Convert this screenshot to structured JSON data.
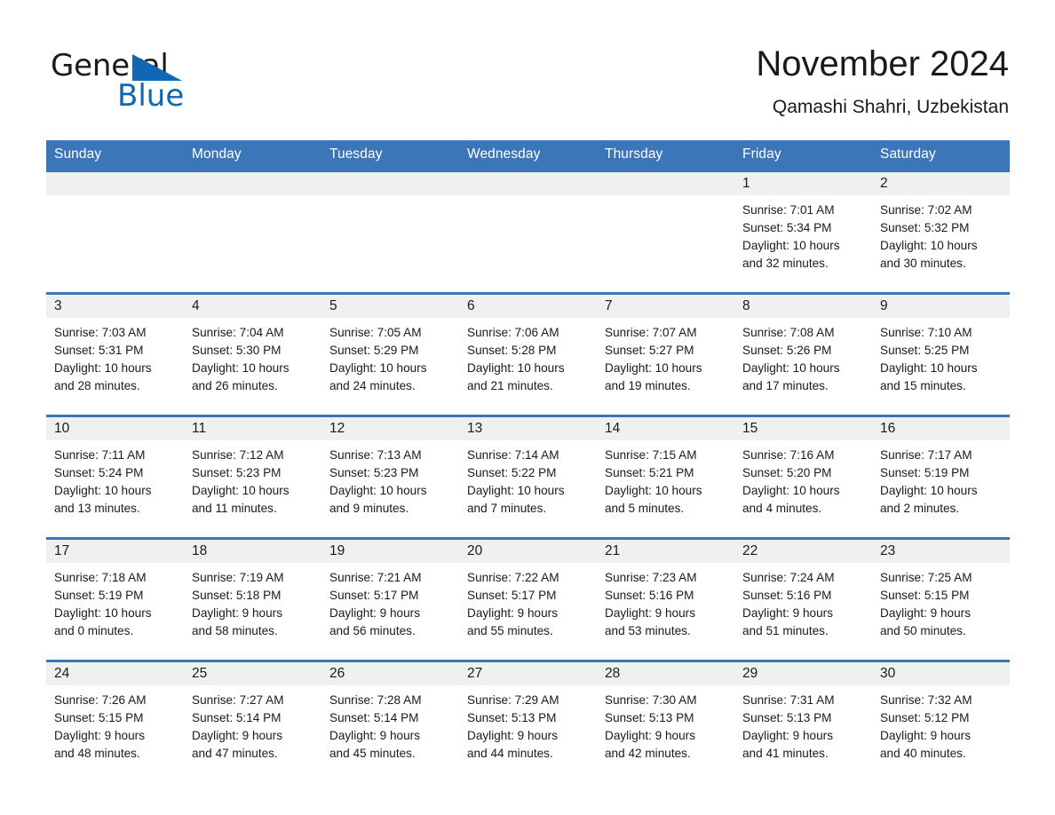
{
  "brand": {
    "word1": "General",
    "word2": "Blue",
    "triangle_color": "#1068b4",
    "text_color": "#1a1a1a"
  },
  "header": {
    "month_title": "November 2024",
    "location": "Qamashi Shahri, Uzbekistan"
  },
  "theme": {
    "header_blue": "#3a76b8",
    "daynum_band": "#f0f0f0",
    "cell_background": "#ffffff",
    "text": "#1a1a1a"
  },
  "weekday_headers": [
    "Sunday",
    "Monday",
    "Tuesday",
    "Wednesday",
    "Thursday",
    "Friday",
    "Saturday"
  ],
  "labels": {
    "sunrise_prefix": "Sunrise:",
    "sunset_prefix": "Sunset:",
    "daylight_prefix": "Daylight:"
  },
  "weeks": [
    [
      {
        "day": "",
        "lines": []
      },
      {
        "day": "",
        "lines": []
      },
      {
        "day": "",
        "lines": []
      },
      {
        "day": "",
        "lines": []
      },
      {
        "day": "",
        "lines": []
      },
      {
        "day": "1",
        "lines": [
          "Sunrise: 7:01 AM",
          "Sunset: 5:34 PM",
          "Daylight: 10 hours",
          "and 32 minutes."
        ]
      },
      {
        "day": "2",
        "lines": [
          "Sunrise: 7:02 AM",
          "Sunset: 5:32 PM",
          "Daylight: 10 hours",
          "and 30 minutes."
        ]
      }
    ],
    [
      {
        "day": "3",
        "lines": [
          "Sunrise: 7:03 AM",
          "Sunset: 5:31 PM",
          "Daylight: 10 hours",
          "and 28 minutes."
        ]
      },
      {
        "day": "4",
        "lines": [
          "Sunrise: 7:04 AM",
          "Sunset: 5:30 PM",
          "Daylight: 10 hours",
          "and 26 minutes."
        ]
      },
      {
        "day": "5",
        "lines": [
          "Sunrise: 7:05 AM",
          "Sunset: 5:29 PM",
          "Daylight: 10 hours",
          "and 24 minutes."
        ]
      },
      {
        "day": "6",
        "lines": [
          "Sunrise: 7:06 AM",
          "Sunset: 5:28 PM",
          "Daylight: 10 hours",
          "and 21 minutes."
        ]
      },
      {
        "day": "7",
        "lines": [
          "Sunrise: 7:07 AM",
          "Sunset: 5:27 PM",
          "Daylight: 10 hours",
          "and 19 minutes."
        ]
      },
      {
        "day": "8",
        "lines": [
          "Sunrise: 7:08 AM",
          "Sunset: 5:26 PM",
          "Daylight: 10 hours",
          "and 17 minutes."
        ]
      },
      {
        "day": "9",
        "lines": [
          "Sunrise: 7:10 AM",
          "Sunset: 5:25 PM",
          "Daylight: 10 hours",
          "and 15 minutes."
        ]
      }
    ],
    [
      {
        "day": "10",
        "lines": [
          "Sunrise: 7:11 AM",
          "Sunset: 5:24 PM",
          "Daylight: 10 hours",
          "and 13 minutes."
        ]
      },
      {
        "day": "11",
        "lines": [
          "Sunrise: 7:12 AM",
          "Sunset: 5:23 PM",
          "Daylight: 10 hours",
          "and 11 minutes."
        ]
      },
      {
        "day": "12",
        "lines": [
          "Sunrise: 7:13 AM",
          "Sunset: 5:23 PM",
          "Daylight: 10 hours",
          "and 9 minutes."
        ]
      },
      {
        "day": "13",
        "lines": [
          "Sunrise: 7:14 AM",
          "Sunset: 5:22 PM",
          "Daylight: 10 hours",
          "and 7 minutes."
        ]
      },
      {
        "day": "14",
        "lines": [
          "Sunrise: 7:15 AM",
          "Sunset: 5:21 PM",
          "Daylight: 10 hours",
          "and 5 minutes."
        ]
      },
      {
        "day": "15",
        "lines": [
          "Sunrise: 7:16 AM",
          "Sunset: 5:20 PM",
          "Daylight: 10 hours",
          "and 4 minutes."
        ]
      },
      {
        "day": "16",
        "lines": [
          "Sunrise: 7:17 AM",
          "Sunset: 5:19 PM",
          "Daylight: 10 hours",
          "and 2 minutes."
        ]
      }
    ],
    [
      {
        "day": "17",
        "lines": [
          "Sunrise: 7:18 AM",
          "Sunset: 5:19 PM",
          "Daylight: 10 hours",
          "and 0 minutes."
        ]
      },
      {
        "day": "18",
        "lines": [
          "Sunrise: 7:19 AM",
          "Sunset: 5:18 PM",
          "Daylight: 9 hours",
          "and 58 minutes."
        ]
      },
      {
        "day": "19",
        "lines": [
          "Sunrise: 7:21 AM",
          "Sunset: 5:17 PM",
          "Daylight: 9 hours",
          "and 56 minutes."
        ]
      },
      {
        "day": "20",
        "lines": [
          "Sunrise: 7:22 AM",
          "Sunset: 5:17 PM",
          "Daylight: 9 hours",
          "and 55 minutes."
        ]
      },
      {
        "day": "21",
        "lines": [
          "Sunrise: 7:23 AM",
          "Sunset: 5:16 PM",
          "Daylight: 9 hours",
          "and 53 minutes."
        ]
      },
      {
        "day": "22",
        "lines": [
          "Sunrise: 7:24 AM",
          "Sunset: 5:16 PM",
          "Daylight: 9 hours",
          "and 51 minutes."
        ]
      },
      {
        "day": "23",
        "lines": [
          "Sunrise: 7:25 AM",
          "Sunset: 5:15 PM",
          "Daylight: 9 hours",
          "and 50 minutes."
        ]
      }
    ],
    [
      {
        "day": "24",
        "lines": [
          "Sunrise: 7:26 AM",
          "Sunset: 5:15 PM",
          "Daylight: 9 hours",
          "and 48 minutes."
        ]
      },
      {
        "day": "25",
        "lines": [
          "Sunrise: 7:27 AM",
          "Sunset: 5:14 PM",
          "Daylight: 9 hours",
          "and 47 minutes."
        ]
      },
      {
        "day": "26",
        "lines": [
          "Sunrise: 7:28 AM",
          "Sunset: 5:14 PM",
          "Daylight: 9 hours",
          "and 45 minutes."
        ]
      },
      {
        "day": "27",
        "lines": [
          "Sunrise: 7:29 AM",
          "Sunset: 5:13 PM",
          "Daylight: 9 hours",
          "and 44 minutes."
        ]
      },
      {
        "day": "28",
        "lines": [
          "Sunrise: 7:30 AM",
          "Sunset: 5:13 PM",
          "Daylight: 9 hours",
          "and 42 minutes."
        ]
      },
      {
        "day": "29",
        "lines": [
          "Sunrise: 7:31 AM",
          "Sunset: 5:13 PM",
          "Daylight: 9 hours",
          "and 41 minutes."
        ]
      },
      {
        "day": "30",
        "lines": [
          "Sunrise: 7:32 AM",
          "Sunset: 5:12 PM",
          "Daylight: 9 hours",
          "and 40 minutes."
        ]
      }
    ]
  ]
}
